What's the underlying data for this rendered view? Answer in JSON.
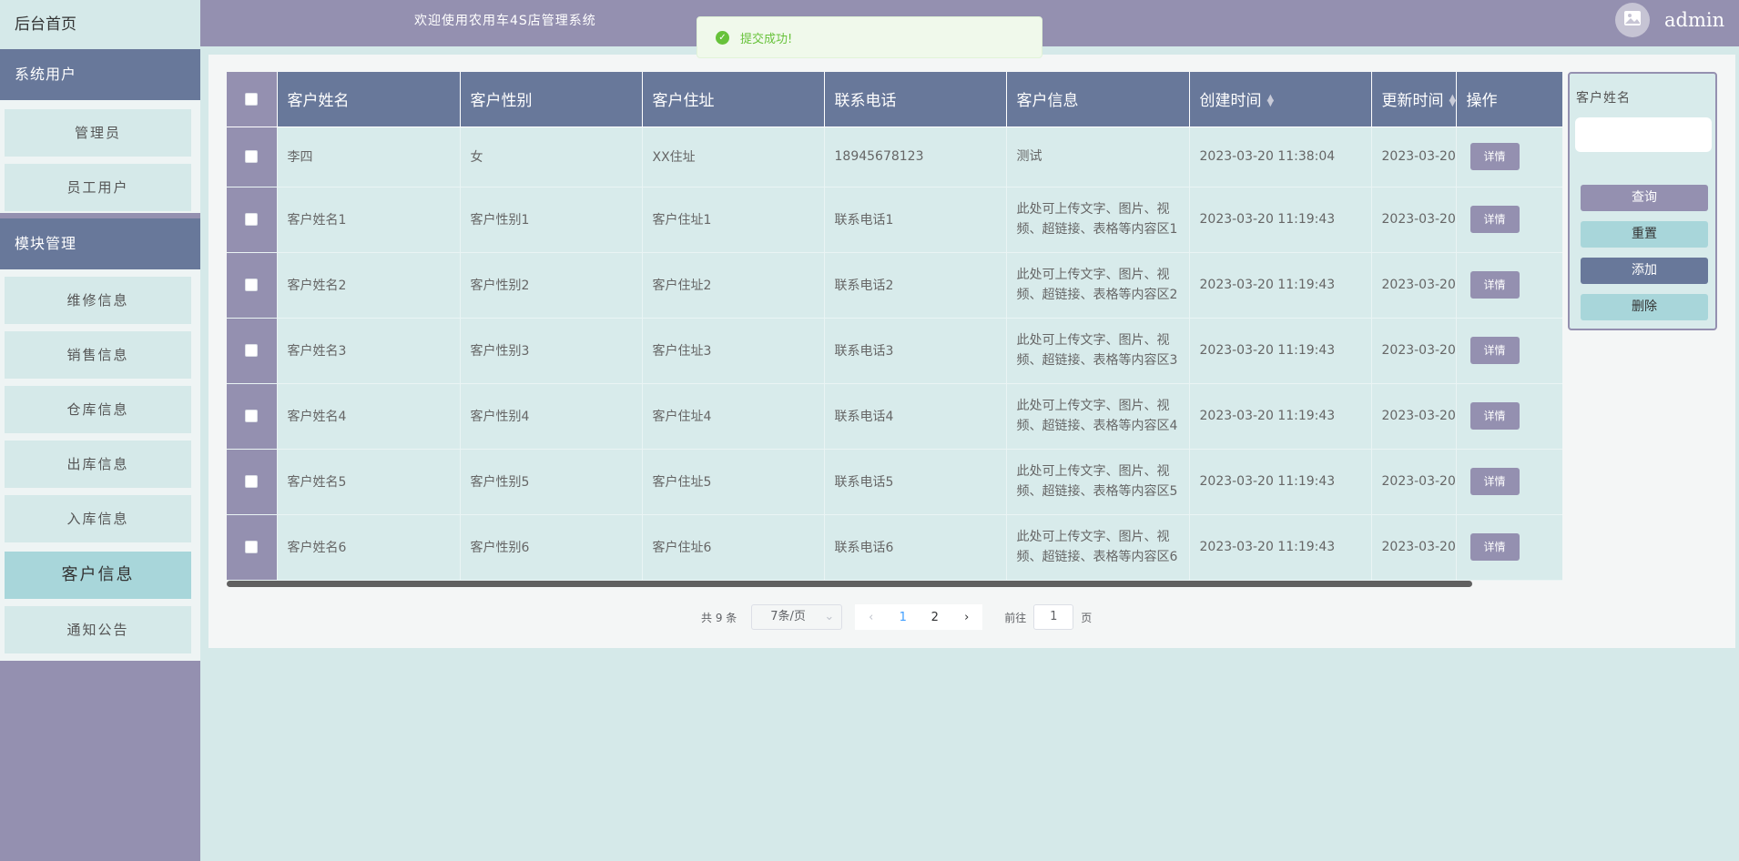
{
  "sidebar": {
    "home": "后台首页",
    "sections": [
      {
        "title": "系统用户",
        "items": [
          "管理员",
          "员工用户"
        ]
      },
      {
        "title": "模块管理",
        "items": [
          "维修信息",
          "销售信息",
          "仓库信息",
          "出库信息",
          "入库信息",
          "客户信息",
          "通知公告"
        ]
      }
    ]
  },
  "header": {
    "title": "欢迎使用农用车4S店管理系统",
    "username": "admin",
    "avatar_icon": "image-icon"
  },
  "toast": {
    "message": "提交成功!",
    "icon": "check-circle-icon",
    "color": "#67c23a"
  },
  "table": {
    "columns": [
      "客户姓名",
      "客户性别",
      "客户住址",
      "联系电话",
      "客户信息",
      "创建时间",
      "更新时间",
      "操作"
    ],
    "detail_label": "详情",
    "rows": [
      {
        "name": "李四",
        "gender": "女",
        "address": "XX住址",
        "phone": "18945678123",
        "info": "测试",
        "created": "2023-03-20 11:38:04",
        "updated": "2023-03-20"
      },
      {
        "name": "客户姓名1",
        "gender": "客户性别1",
        "address": "客户住址1",
        "phone": "联系电话1",
        "info": "此处可上传文字、图片、视频、超链接、表格等内容区1",
        "created": "2023-03-20 11:19:43",
        "updated": "2023-03-20"
      },
      {
        "name": "客户姓名2",
        "gender": "客户性别2",
        "address": "客户住址2",
        "phone": "联系电话2",
        "info": "此处可上传文字、图片、视频、超链接、表格等内容区2",
        "created": "2023-03-20 11:19:43",
        "updated": "2023-03-20"
      },
      {
        "name": "客户姓名3",
        "gender": "客户性别3",
        "address": "客户住址3",
        "phone": "联系电话3",
        "info": "此处可上传文字、图片、视频、超链接、表格等内容区3",
        "created": "2023-03-20 11:19:43",
        "updated": "2023-03-20"
      },
      {
        "name": "客户姓名4",
        "gender": "客户性别4",
        "address": "客户住址4",
        "phone": "联系电话4",
        "info": "此处可上传文字、图片、视频、超链接、表格等内容区4",
        "created": "2023-03-20 11:19:43",
        "updated": "2023-03-20"
      },
      {
        "name": "客户姓名5",
        "gender": "客户性别5",
        "address": "客户住址5",
        "phone": "联系电话5",
        "info": "此处可上传文字、图片、视频、超链接、表格等内容区5",
        "created": "2023-03-20 11:19:43",
        "updated": "2023-03-20"
      },
      {
        "name": "客户姓名6",
        "gender": "客户性别6",
        "address": "客户住址6",
        "phone": "联系电话6",
        "info": "此处可上传文字、图片、视频、超链接、表格等内容区6",
        "created": "2023-03-20 11:19:43",
        "updated": "2023-03-20"
      }
    ]
  },
  "pagination": {
    "total_text": "共 9 条",
    "page_size": "7条/页",
    "pages": [
      "1",
      "2"
    ],
    "current_page": "1",
    "goto_prefix": "前往",
    "goto_value": "1",
    "goto_suffix": "页"
  },
  "search": {
    "label": "客户姓名",
    "input_value": "",
    "query": "查询",
    "reset": "重置",
    "add": "添加",
    "delete": "删除"
  },
  "colors": {
    "sidebar": "#9490b0",
    "header_cell": "#68789a",
    "row_bg": "#d8ebeb",
    "active_item": "#a8d6da"
  }
}
